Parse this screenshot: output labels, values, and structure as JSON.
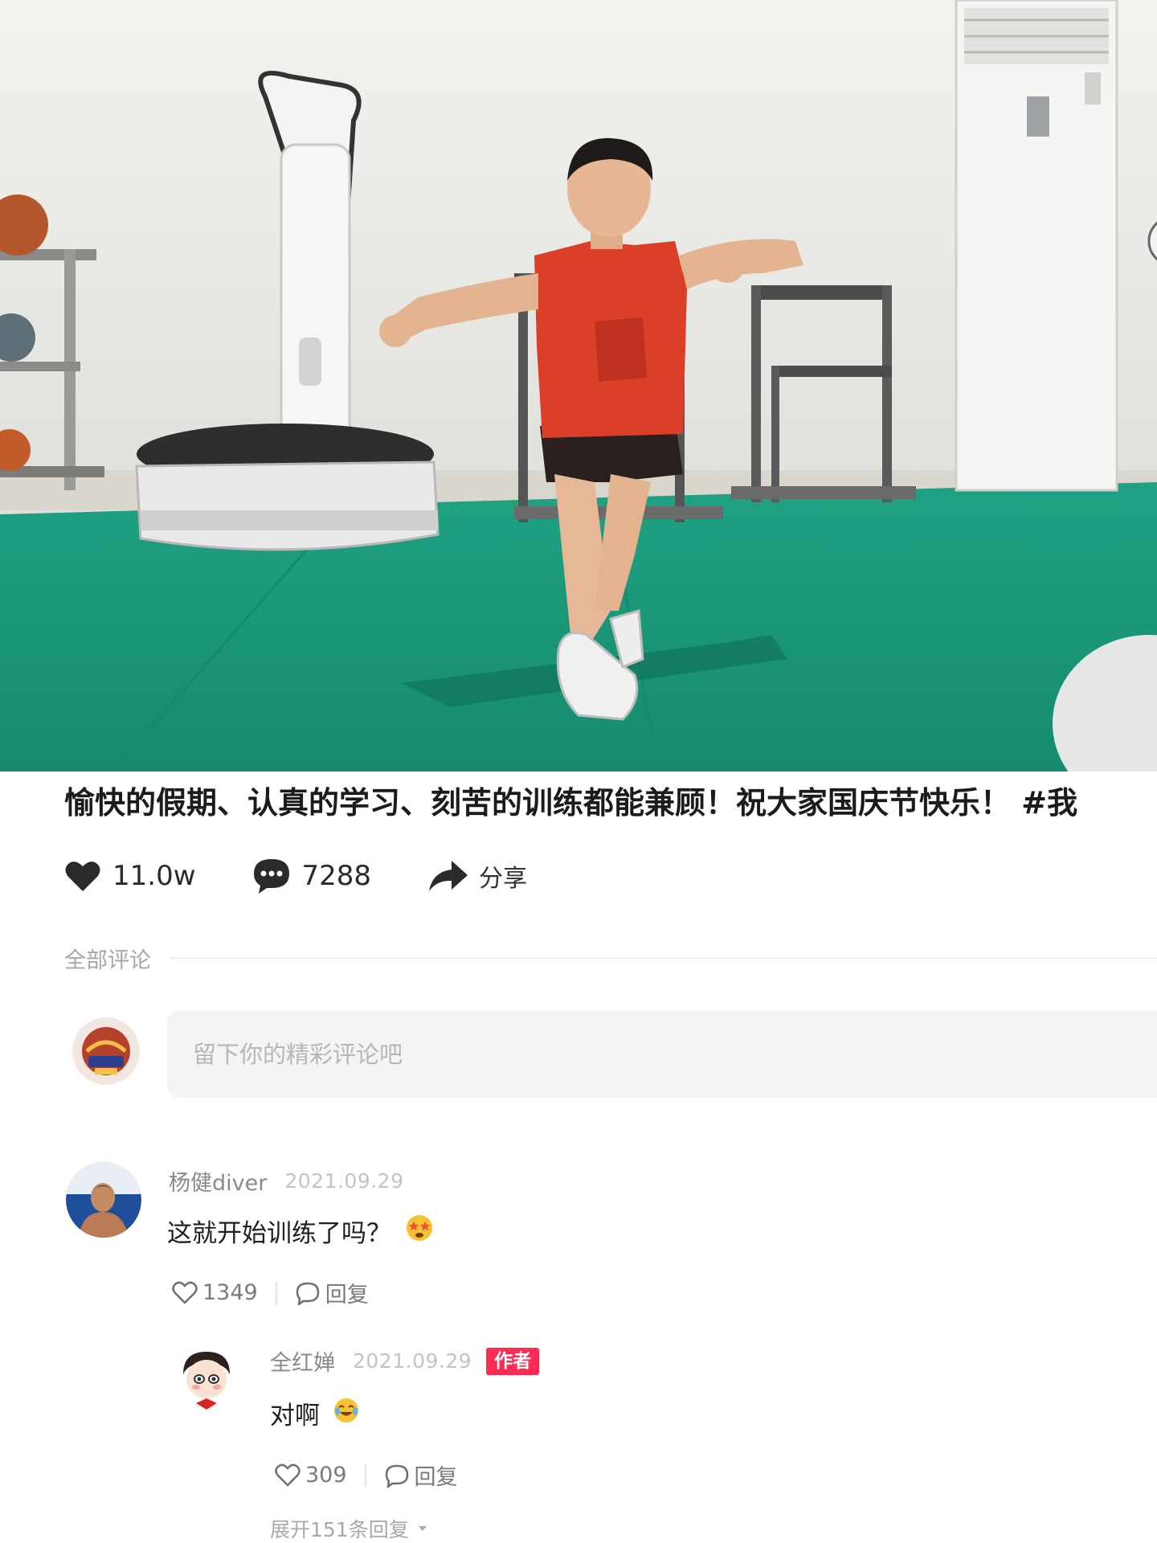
{
  "post": {
    "caption": "愉快的假期、认真的学习、刻苦的训练都能兼顾！祝大家国庆节快乐！ #我",
    "likes": "11.0w",
    "comments_count": "7288",
    "share_label": "分享"
  },
  "comments_section": {
    "header": "全部评论",
    "input_placeholder": "留下你的精彩评论吧"
  },
  "comments": [
    {
      "user": "杨健diver",
      "time": "2021.09.29",
      "text": "这就开始训练了吗？",
      "likes": "1349",
      "reply_label": "回复",
      "replies": [
        {
          "user": "全红婵",
          "time": "2021.09.29",
          "badge": "作者",
          "text": "对啊",
          "likes": "309",
          "reply_label": "回复"
        }
      ],
      "expand_label": "展开151条回复"
    }
  ],
  "colors": {
    "accent": "#fe2c55",
    "floor": "#1e9a7f"
  },
  "icons": [
    "heart-icon",
    "comment-bubble-icon",
    "share-arrow-icon",
    "chevron-down-icon"
  ]
}
